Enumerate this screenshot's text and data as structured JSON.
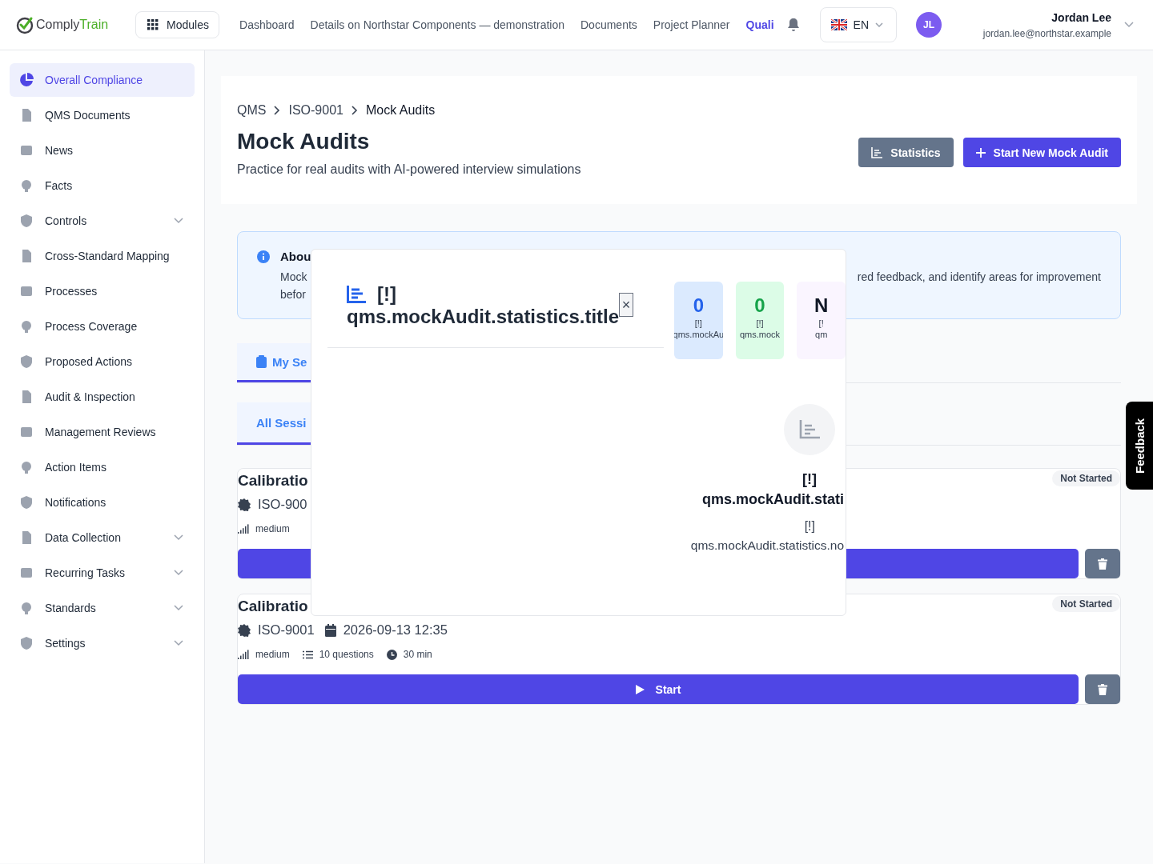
{
  "brand": {
    "part1": "Comply",
    "part2": "Train"
  },
  "modules_button": "Modules",
  "nav": [
    {
      "label": "Dashboard",
      "selected": false
    },
    {
      "label": "Details on Northstar Components — demonstration",
      "selected": false
    },
    {
      "label": "Documents",
      "selected": false
    },
    {
      "label": "Project Planner",
      "selected": false
    },
    {
      "label": "Quali",
      "selected": true
    }
  ],
  "language": "EN",
  "user": {
    "initials": "JL",
    "name": "Jordan Lee",
    "email": "jordan.lee@northstar.example"
  },
  "sidebar": {
    "items": [
      {
        "label": "Overall Compliance",
        "selected": true,
        "has_submenu": false
      },
      {
        "label": "QMS Documents",
        "selected": false,
        "has_submenu": false
      },
      {
        "label": "News",
        "selected": false,
        "has_submenu": false
      },
      {
        "label": "Facts",
        "selected": false,
        "has_submenu": false
      },
      {
        "label": "Controls",
        "selected": false,
        "has_submenu": true
      },
      {
        "label": "Cross-Standard Mapping",
        "selected": false,
        "has_submenu": false
      },
      {
        "label": "Processes",
        "selected": false,
        "has_submenu": false
      },
      {
        "label": "Process Coverage",
        "selected": false,
        "has_submenu": false
      },
      {
        "label": "Proposed Actions",
        "selected": false,
        "has_submenu": false
      },
      {
        "label": "Audit & Inspection",
        "selected": false,
        "has_submenu": false
      },
      {
        "label": "Management Reviews",
        "selected": false,
        "has_submenu": false
      },
      {
        "label": "Action Items",
        "selected": false,
        "has_submenu": false
      },
      {
        "label": "Notifications",
        "selected": false,
        "has_submenu": false
      },
      {
        "label": "Data Collection",
        "selected": false,
        "has_submenu": true
      },
      {
        "label": "Recurring Tasks",
        "selected": false,
        "has_submenu": true
      },
      {
        "label": "Standards",
        "selected": false,
        "has_submenu": true
      },
      {
        "label": "Settings",
        "selected": false,
        "has_submenu": true
      }
    ]
  },
  "breadcrumbs": [
    "QMS",
    "ISO-9001",
    "Mock Audits"
  ],
  "page_title": "Mock Audits",
  "page_subtitle": "Practice for real audits with AI-powered interview simulations",
  "header_buttons": [
    {
      "label": "Statistics",
      "kind": "secondary"
    },
    {
      "label": "Start New Mock Audit",
      "kind": "primary"
    }
  ],
  "info": {
    "title": "Abou",
    "line1_start": "Mock",
    "line1_end": "red feedback, and identify areas for improvement",
    "line2": "befor"
  },
  "tabs": [
    {
      "label": "My Se",
      "selected": true
    }
  ],
  "filter_tabs": [
    {
      "label": "All Sessi",
      "selected": true
    }
  ],
  "sessions": [
    {
      "title": "Calibratio",
      "standard": "ISO-900",
      "difficulty": "medium",
      "status": "Not Started"
    },
    {
      "title": "Calibratio",
      "standard": "ISO-9001",
      "date": "2026-09-13 12:35",
      "difficulty": "medium",
      "questions": "10 questions",
      "duration": "30 min",
      "status": "Not Started",
      "start_label": "Start"
    }
  ],
  "modal": {
    "title_line1": "[!]",
    "title_line2": "qms.mockAudit.statistics.title",
    "close": "×",
    "stats": [
      {
        "value": "0",
        "label1": "[!]",
        "label2": "qms.mockAu",
        "color": "#dbeafe"
      },
      {
        "value": "0",
        "label1": "[!]",
        "label2": "qms.mock",
        "color": "#dcfce7"
      },
      {
        "value": "N",
        "label1": "[!",
        "label2": "qm",
        "color": "#faf5ff"
      }
    ],
    "empty_title1": "[!]",
    "empty_title2": "qms.mockAudit.stati",
    "empty_text1": "[!]",
    "empty_text2": "qms.mockAudit.statistics.no"
  },
  "feedback": "Feedback"
}
